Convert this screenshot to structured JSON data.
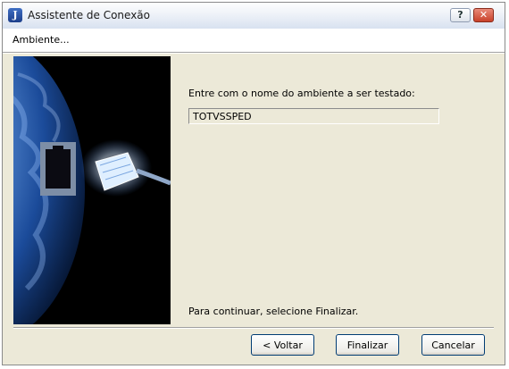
{
  "window": {
    "title": "Assistente de Conexão",
    "icon": "app-icon",
    "help_label": "?",
    "close_label": "✕"
  },
  "header": {
    "label": "Ambiente..."
  },
  "main": {
    "prompt": "Entre com o nome do ambiente a ser testado:",
    "environment_value": "TOTVSSPED",
    "continue_text": "Para continuar, selecione Finalizar."
  },
  "buttons": {
    "back": "< Voltar",
    "finish": "Finalizar",
    "cancel": "Cancelar"
  },
  "colors": {
    "window_bg": "#ece9d8",
    "button_border": "#003c74",
    "close_button": "#c8412a"
  }
}
